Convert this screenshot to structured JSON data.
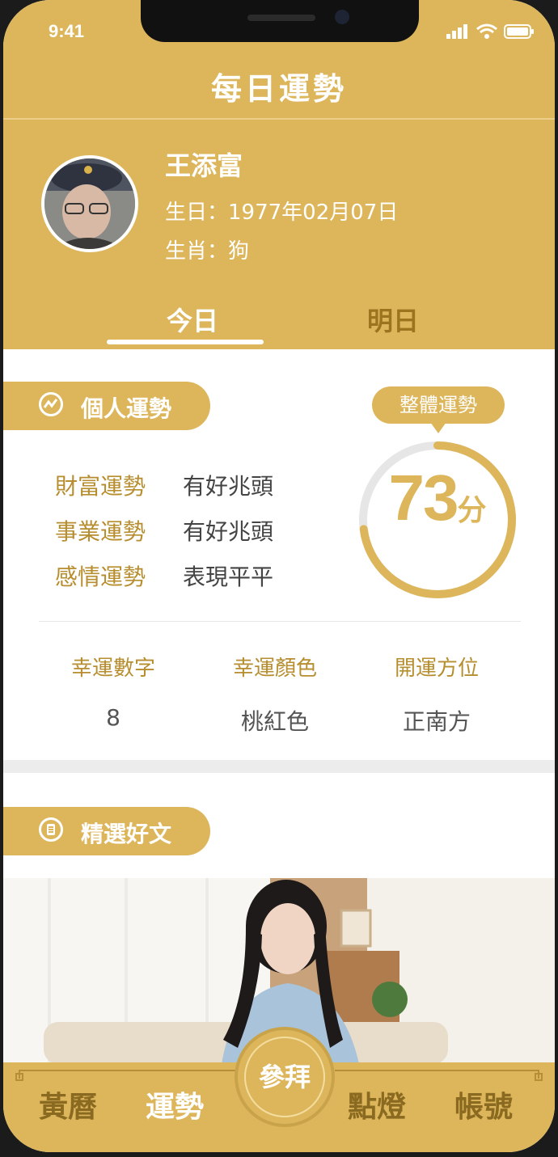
{
  "status_bar": {
    "time": "9:41"
  },
  "nav": {
    "title": "每日運勢"
  },
  "profile": {
    "name": "王添富",
    "birthday": "生日：1977年02月07日",
    "zodiac": "生肖：狗"
  },
  "tabs": [
    {
      "label": "今日",
      "active": true
    },
    {
      "label": "明日",
      "active": false
    }
  ],
  "personal": {
    "title": "個人運勢",
    "items": [
      {
        "key": "財富運勢",
        "value": "有好兆頭"
      },
      {
        "key": "事業運勢",
        "value": "有好兆頭"
      },
      {
        "key": "感情運勢",
        "value": "表現平平"
      }
    ],
    "overall_label": "整體運勢",
    "score": "73",
    "score_unit": "分",
    "score_progress": 0.73
  },
  "lucky": [
    {
      "key": "幸運數字",
      "value": "8"
    },
    {
      "key": "幸運顏色",
      "value": "桃紅色"
    },
    {
      "key": "開運方位",
      "value": "正南方"
    }
  ],
  "articles": {
    "title": "精選好文"
  },
  "bottom_nav": {
    "items": [
      "黃曆",
      "運勢",
      "點燈",
      "帳號"
    ],
    "center": "參拜"
  },
  "colors": {
    "gold": "#ddb65c",
    "gold_text": "#b78e2f",
    "active_tab_text": "#ffffff",
    "inactive_tab_text": "#9a741f"
  }
}
